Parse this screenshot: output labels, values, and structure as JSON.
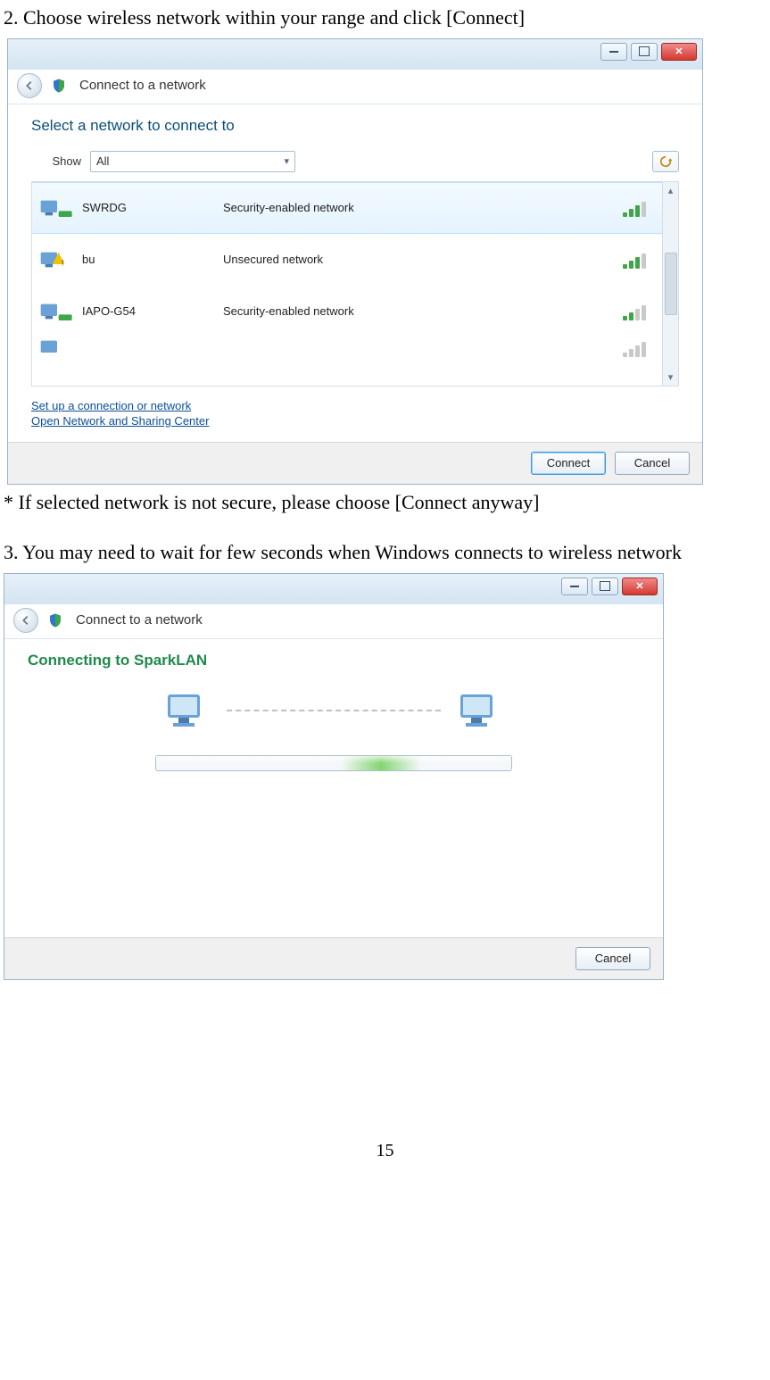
{
  "doc": {
    "step2": "2. Choose wireless network within your range and click [Connect]",
    "note": "* If selected network is not secure, please choose [Connect anyway]",
    "step3": "3. You may need to wait for few seconds when Windows connects to wireless network",
    "page_number": "15"
  },
  "dialog1": {
    "title": "Connect to a network",
    "heading": "Select a network to connect to",
    "show_label": "Show",
    "filter_value": "All",
    "networks": [
      {
        "name": "SWRDG",
        "desc": "Security-enabled network",
        "signal": 3,
        "selected": true
      },
      {
        "name": "bu",
        "desc": "Unsecured network",
        "signal": 3,
        "selected": false
      },
      {
        "name": "IAPO-G54",
        "desc": "Security-enabled network",
        "signal": 2,
        "selected": false
      }
    ],
    "link_setup": "Set up a connection or network",
    "link_center": "Open Network and Sharing Center",
    "btn_connect": "Connect",
    "btn_cancel": "Cancel"
  },
  "dialog2": {
    "title": "Connect to a network",
    "heading": "Connecting to SparkLAN",
    "btn_cancel": "Cancel"
  }
}
